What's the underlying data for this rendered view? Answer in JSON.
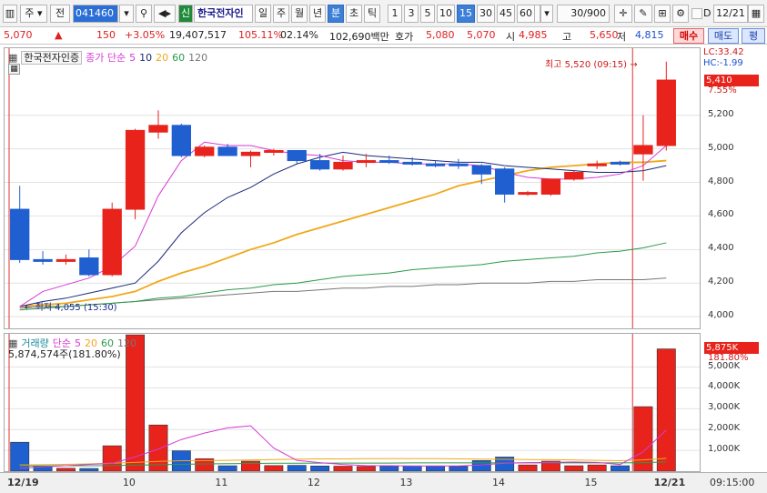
{
  "toolbar": {
    "market_label": "주",
    "type_label": "전",
    "code": "041460",
    "search_icon": "magnifier-icon",
    "sound_icon": "speaker-icon",
    "shin_label": "신",
    "stock_name": "한국전자인",
    "periods": [
      "일",
      "주",
      "월",
      "년",
      "분",
      "초",
      "틱"
    ],
    "active_period": "분",
    "intervals": [
      "1",
      "3",
      "5",
      "10",
      "15",
      "30",
      "45",
      "60"
    ],
    "active_interval": "15",
    "interval_value": "15",
    "count_value": "30/900",
    "d_label": "D",
    "date_value": "12/21"
  },
  "info": {
    "price": "5,070",
    "change": "150",
    "change_rate": "+3.05%",
    "volume": "19,407,517",
    "vol_rate": "105.11%",
    "turnover": "02.14%",
    "amount": "102,690백만",
    "hoga_label": "호가",
    "ask": "5,080",
    "bid": "5,070",
    "open_label": "시",
    "open": "4,985",
    "high_label": "고",
    "high": "5,650",
    "low_label": "저",
    "low": "4,815",
    "buy_label": "매수",
    "sell_label": "매도",
    "extra_label": "평"
  },
  "main_legend": {
    "name": "한국전자인증",
    "series_label": "종가 단순",
    "ma_labels": [
      "5",
      "10",
      "20",
      "60",
      "120"
    ],
    "lc": "LC:33.42",
    "hc": "HC:-1.99"
  },
  "annotations": {
    "high_text": "최고 5,520 (09:15)",
    "low_text": "최저 4,055 (15:30)",
    "current_price": "5,410",
    "current_rate": "7.55%"
  },
  "vol_legend": {
    "name": "거래량",
    "series_label": "단순",
    "ma_labels": [
      "5",
      "20",
      "60",
      "120"
    ],
    "value_text": "5,874,574주(181.80%)",
    "current_vol": "5,875K",
    "current_rate": "181.80%"
  },
  "colors": {
    "up": "#e8231c",
    "down": "#1f5fd0",
    "ma5": "#d63ad6",
    "ma10": "#1a2a7a",
    "ma20": "#f0a81a",
    "ma60": "#2a9a4a",
    "ma120": "#777777"
  },
  "chart_data": {
    "type": "candlestick",
    "y_ticks": [
      4000,
      4200,
      4400,
      4600,
      4800,
      5000,
      5200
    ],
    "y_tick_labels": [
      "4,000",
      "4,200",
      "4,400",
      "4,600",
      "4,800",
      "5,000",
      "5,200"
    ],
    "ylim": [
      3930,
      5600
    ],
    "x_ticks": [
      "12/19",
      "10",
      "11",
      "12",
      "13",
      "14",
      "15",
      "12/21"
    ],
    "vol_ticks": [
      "1,000K",
      "2,000K",
      "3,000K",
      "4,000K",
      "5,000K"
    ],
    "vol_tick_values": [
      1000,
      2000,
      3000,
      4000,
      5000
    ],
    "vol_ylim": [
      0,
      6600
    ],
    "candles": [
      {
        "o": 4640,
        "h": 4780,
        "l": 4320,
        "c": 4340
      },
      {
        "o": 4340,
        "h": 4390,
        "l": 4310,
        "c": 4330
      },
      {
        "o": 4330,
        "h": 4370,
        "l": 4310,
        "c": 4340
      },
      {
        "o": 4350,
        "h": 4400,
        "l": 4240,
        "c": 4250
      },
      {
        "o": 4250,
        "h": 4680,
        "l": 4240,
        "c": 4640
      },
      {
        "o": 4640,
        "h": 5120,
        "l": 4580,
        "c": 5110
      },
      {
        "o": 5100,
        "h": 5230,
        "l": 5060,
        "c": 5140
      },
      {
        "o": 5140,
        "h": 5150,
        "l": 4950,
        "c": 4960
      },
      {
        "o": 4960,
        "h": 5020,
        "l": 4950,
        "c": 5010
      },
      {
        "o": 5010,
        "h": 5030,
        "l": 4960,
        "c": 4960
      },
      {
        "o": 4960,
        "h": 4990,
        "l": 4890,
        "c": 4980
      },
      {
        "o": 4980,
        "h": 5000,
        "l": 4960,
        "c": 4990
      },
      {
        "o": 4990,
        "h": 4990,
        "l": 4910,
        "c": 4930
      },
      {
        "o": 4930,
        "h": 4970,
        "l": 4870,
        "c": 4880
      },
      {
        "o": 4880,
        "h": 4960,
        "l": 4870,
        "c": 4920
      },
      {
        "o": 4920,
        "h": 4970,
        "l": 4890,
        "c": 4930
      },
      {
        "o": 4930,
        "h": 4960,
        "l": 4910,
        "c": 4920
      },
      {
        "o": 4920,
        "h": 4950,
        "l": 4900,
        "c": 4910
      },
      {
        "o": 4910,
        "h": 4930,
        "l": 4890,
        "c": 4900
      },
      {
        "o": 4910,
        "h": 4940,
        "l": 4880,
        "c": 4900
      },
      {
        "o": 4900,
        "h": 4910,
        "l": 4790,
        "c": 4850
      },
      {
        "o": 4880,
        "h": 4890,
        "l": 4680,
        "c": 4730
      },
      {
        "o": 4730,
        "h": 4750,
        "l": 4720,
        "c": 4740
      },
      {
        "o": 4730,
        "h": 4820,
        "l": 4720,
        "c": 4820
      },
      {
        "o": 4820,
        "h": 4870,
        "l": 4810,
        "c": 4860
      },
      {
        "o": 4900,
        "h": 4930,
        "l": 4880,
        "c": 4910
      },
      {
        "o": 4920,
        "h": 4930,
        "l": 4900,
        "c": 4910
      },
      {
        "o": 4970,
        "h": 5200,
        "l": 4810,
        "c": 5020
      },
      {
        "o": 5020,
        "h": 5520,
        "l": 4990,
        "c": 5410
      }
    ],
    "volumes": [
      1390,
      240,
      140,
      130,
      1220,
      6550,
      2220,
      980,
      600,
      260,
      480,
      270,
      280,
      250,
      240,
      230,
      240,
      250,
      240,
      230,
      510,
      680,
      300,
      480,
      260,
      300,
      260,
      3100,
      5875
    ],
    "ma5": [
      4060,
      4150,
      4190,
      4230,
      4300,
      4420,
      4720,
      4930,
      5040,
      5020,
      5020,
      4990,
      4970,
      4960,
      4930,
      4920,
      4920,
      4910,
      4910,
      4910,
      4900,
      4860,
      4830,
      4820,
      4820,
      4830,
      4850,
      4900,
      5020
    ],
    "ma10": [
      4060,
      4090,
      4110,
      4140,
      4170,
      4200,
      4330,
      4500,
      4620,
      4710,
      4770,
      4850,
      4910,
      4950,
      4980,
      4960,
      4950,
      4940,
      4930,
      4920,
      4920,
      4900,
      4890,
      4880,
      4870,
      4860,
      4860,
      4870,
      4900
    ],
    "ma20": [
      4060,
      4070,
      4080,
      4100,
      4120,
      4150,
      4210,
      4260,
      4300,
      4350,
      4400,
      4440,
      4490,
      4530,
      4570,
      4610,
      4650,
      4690,
      4730,
      4780,
      4810,
      4840,
      4870,
      4890,
      4900,
      4910,
      4920,
      4920,
      4930
    ],
    "ma60": [
      4040,
      4050,
      4060,
      4070,
      4080,
      4090,
      4110,
      4120,
      4140,
      4160,
      4170,
      4190,
      4200,
      4220,
      4240,
      4250,
      4260,
      4280,
      4290,
      4300,
      4310,
      4330,
      4340,
      4350,
      4360,
      4380,
      4390,
      4410,
      4440
    ],
    "ma120": [
      4050,
      4060,
      4060,
      4070,
      4080,
      4090,
      4100,
      4110,
      4120,
      4130,
      4140,
      4150,
      4150,
      4160,
      4170,
      4170,
      4180,
      4180,
      4190,
      4190,
      4200,
      4200,
      4200,
      4210,
      4210,
      4220,
      4220,
      4220,
      4230
    ],
    "vol_ma5": [
      140,
      200,
      260,
      330,
      370,
      690,
      1060,
      1520,
      1830,
      2080,
      2180,
      1110,
      520,
      410,
      320,
      270,
      260,
      250,
      250,
      250,
      300,
      380,
      410,
      420,
      440,
      420,
      320,
      930,
      1980
    ],
    "vol_ma20": [
      300,
      310,
      330,
      350,
      380,
      420,
      470,
      500,
      510,
      520,
      540,
      560,
      580,
      590,
      590,
      600,
      600,
      600,
      600,
      590,
      580,
      570,
      560,
      550,
      540,
      520,
      500,
      540,
      620
    ],
    "vol_ma60": [
      250,
      250,
      260,
      260,
      270,
      290,
      310,
      330,
      350,
      360,
      370,
      380,
      380,
      390,
      390,
      390,
      390,
      400,
      400,
      400,
      400,
      400,
      400,
      400,
      400,
      400,
      400,
      410,
      440
    ]
  },
  "time_readout": "09:15:00"
}
